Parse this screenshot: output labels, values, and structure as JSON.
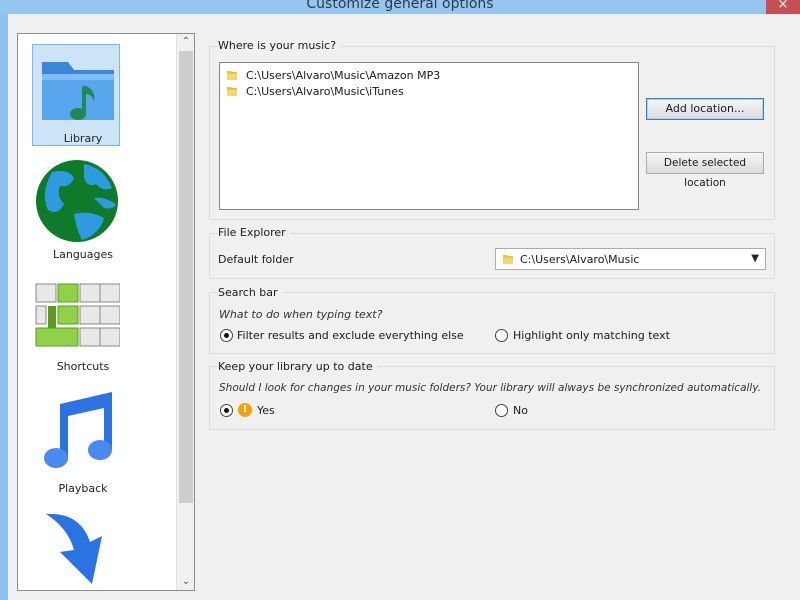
{
  "window": {
    "title": "Customize general options",
    "close_glyph": "×"
  },
  "sidebar": {
    "items": [
      {
        "label": "Library",
        "icon": "music-folder-icon",
        "selected": true
      },
      {
        "label": "Languages",
        "icon": "globe-icon"
      },
      {
        "label": "Shortcuts",
        "icon": "keyboard-keys-icon"
      },
      {
        "label": "Playback",
        "icon": "music-note-icon"
      },
      {
        "label": "",
        "icon": "down-arrow-icon"
      }
    ]
  },
  "music_locations": {
    "title": "Where is your music?",
    "items": [
      "C:\\Users\\Alvaro\\Music\\Amazon MP3",
      "C:\\Users\\Alvaro\\Music\\iTunes"
    ],
    "add_button": "Add location...",
    "delete_button": "Delete selected location"
  },
  "file_explorer": {
    "title": "File Explorer",
    "default_folder_label": "Default folder",
    "default_folder_value": "C:\\Users\\Alvaro\\Music"
  },
  "search_bar": {
    "title": "Search bar",
    "question": "What to do when typing text?",
    "option_filter": "Filter results and exclude everything else",
    "option_highlight": "Highlight only matching text",
    "selected": "filter"
  },
  "library_sync": {
    "title": "Keep your library up to date",
    "question": "Should I look for changes in your music folders? Your library will always be synchronized automatically.",
    "option_yes": "Yes",
    "option_no": "No",
    "selected": "yes"
  },
  "colors": {
    "accent": "#3c7fb1",
    "selection": "#cde4f7",
    "title_bar": "#96c6f0",
    "close_button": "#c75050"
  }
}
